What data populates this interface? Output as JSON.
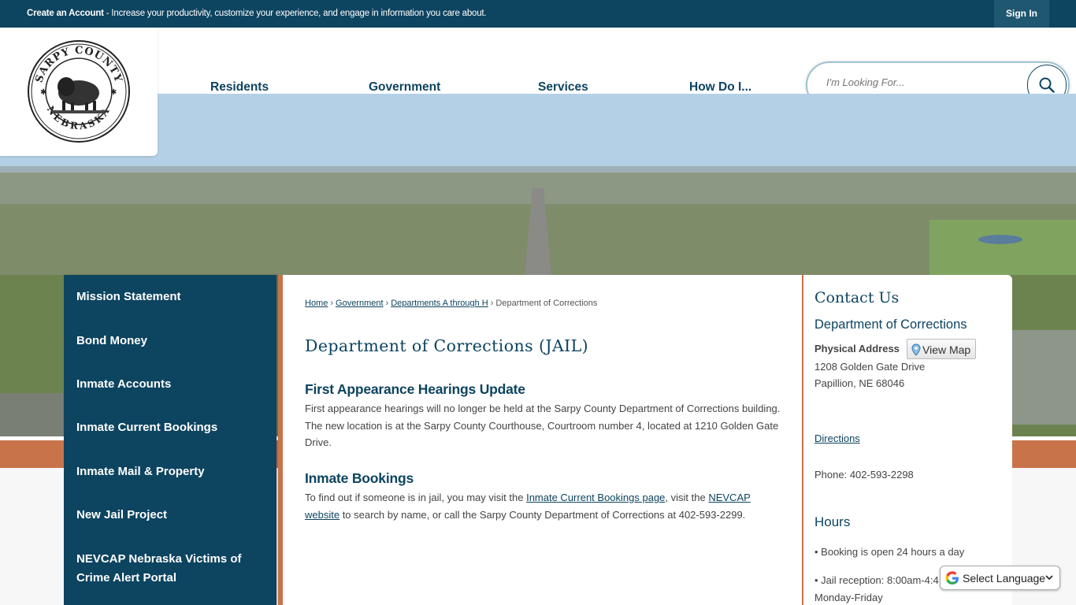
{
  "topbar": {
    "create_account": "Create an Account",
    "message": " - Increase your productivity, customize your experience, and engage in information you care about.",
    "sign_in": "Sign In"
  },
  "header": {
    "logo_text_top": "SARPY COUNTY",
    "logo_text_bottom": "NEBRASKA",
    "nav": [
      "Residents",
      "Government",
      "Services",
      "How Do I..."
    ],
    "search_placeholder": "I'm Looking For..."
  },
  "sidebar": {
    "items": [
      "Mission Statement",
      "Bond Money",
      "Inmate Accounts",
      "Inmate Current Bookings",
      "Inmate Mail & Property",
      "New Jail Project",
      "NEVCAP Nebraska Victims of",
      "Crime Alert Portal"
    ]
  },
  "breadcrumb": {
    "home": "Home",
    "government": "Government",
    "departments": "Departments A through H",
    "current": "Department of Corrections",
    "separator": "›"
  },
  "main": {
    "title": "Department of Corrections (JAIL)",
    "section1_heading": "First Appearance Hearings Update",
    "section1_text": "First appearance hearings will no longer be held at the Sarpy County Department of Corrections building. The new location is at the Sarpy County Courthouse, Courtroom number 4, located at 1210 Golden Gate Drive.",
    "section2_heading": "Inmate Bookings",
    "section2_pre": "To find out if someone is in jail, you may visit the ",
    "section2_link1": "Inmate Current Bookings page",
    "section2_mid": ", visit the ",
    "section2_link2": "NEVCAP website",
    "section2_post": " to search by name, or call the Sarpy County Department of Corrections at 402-593-2299."
  },
  "contact": {
    "title": "Contact Us",
    "department": "Department of Corrections",
    "physical_label": "Physical Address",
    "view_map": "View Map",
    "address_line1": "1208 Golden Gate Drive",
    "address_line2": "Papillion, NE 68046",
    "directions": "Directions",
    "phone": "Phone: 402-593-2298",
    "hours_title": "Hours",
    "hours_line1": "• Booking is open 24 hours a day",
    "hours_line2": "• Jail reception: 8:00am-4:4",
    "hours_line3": "Monday-Friday"
  },
  "translate": {
    "label": "Select Language"
  },
  "colors": {
    "navy": "#0d4460",
    "accent_orange": "#c8734a"
  }
}
